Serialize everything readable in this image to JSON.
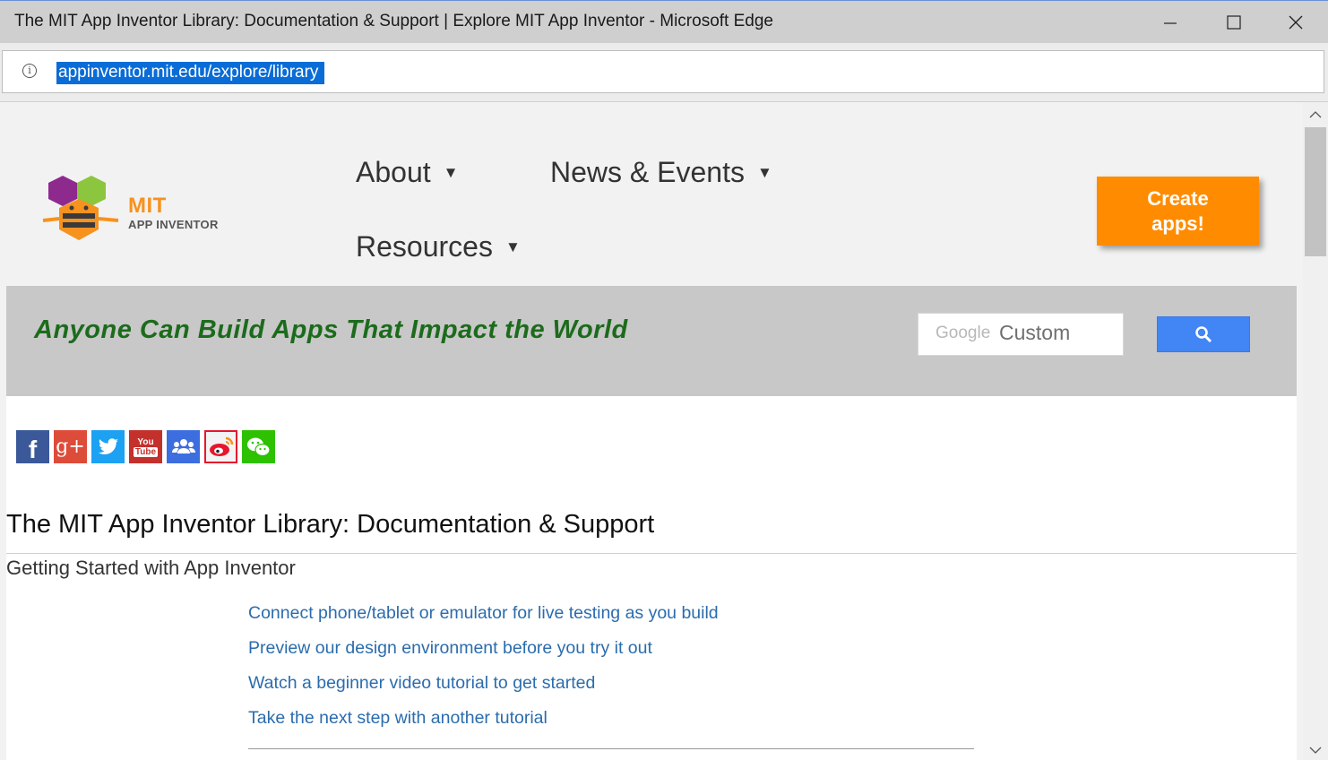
{
  "window": {
    "title": "The MIT App Inventor Library: Documentation & Support | Explore MIT App Inventor - Microsoft Edge",
    "minimize_icon": "minimize-icon",
    "maximize_icon": "maximize-icon",
    "close_icon": "close-icon"
  },
  "address_bar": {
    "url": "appinventor.mit.edu/explore/library",
    "info_glyph": "i"
  },
  "header": {
    "logo": {
      "mit": "MIT",
      "sub": "APP INVENTOR"
    },
    "nav": [
      {
        "label": "About"
      },
      {
        "label": "News & Events"
      },
      {
        "label": "Resources"
      }
    ],
    "caret": "▼",
    "cta": {
      "line1": "Create",
      "line2": "apps!"
    }
  },
  "banner": {
    "tagline": "Anyone Can Build Apps That Impact the World",
    "search": {
      "brand": "Google",
      "placeholder": "Custom"
    }
  },
  "social": [
    {
      "name": "facebook",
      "glyph": "f",
      "color": "#3b5998"
    },
    {
      "name": "google-plus",
      "glyph": "g+",
      "color": "#dd4b39"
    },
    {
      "name": "twitter",
      "color": "#1da1f2"
    },
    {
      "name": "youtube",
      "glyph": "You",
      "glyph2": "Tube",
      "color": "#c4302b"
    },
    {
      "name": "group",
      "color": "#3d6ee0"
    },
    {
      "name": "weibo",
      "color": "#e6162d"
    },
    {
      "name": "wechat",
      "color": "#2dc100"
    }
  ],
  "content": {
    "heading": "The MIT App Inventor Library: Documentation & Support",
    "subheading": "Getting Started with App Inventor",
    "links": [
      "Connect phone/tablet or emulator for live testing as you build",
      "Preview our design environment before you try it out",
      "Watch a beginner video tutorial to get started",
      "Take the next step with another tutorial"
    ]
  }
}
